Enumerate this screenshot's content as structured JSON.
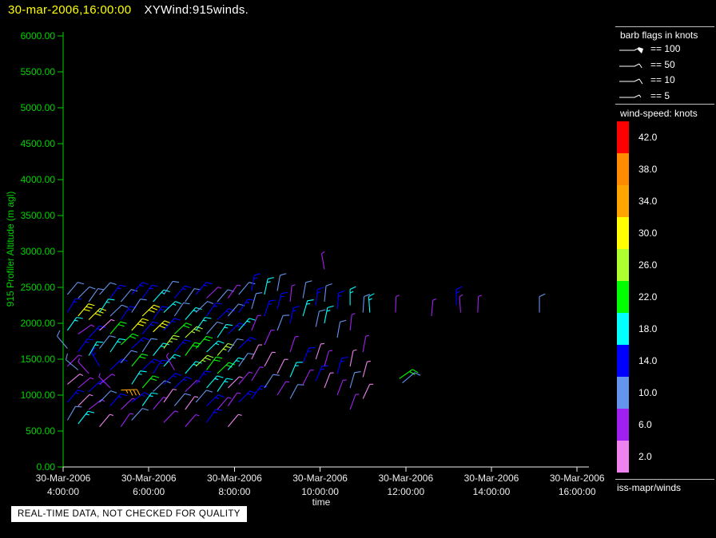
{
  "header": {
    "timestamp": "30-mar-2006,16:00:00",
    "title": "XYWind:915winds."
  },
  "banner": {
    "text": "REAL-TIME DATA, NOT CHECKED FOR QUALITY"
  },
  "legend": {
    "barb_flags_title": "barb flags in knots",
    "barb_flags": [
      {
        "label": "== 100",
        "knots": 100
      },
      {
        "label": "== 50",
        "knots": 50
      },
      {
        "label": "== 10",
        "knots": 10
      },
      {
        "label": "== 5",
        "knots": 5
      }
    ],
    "colorbar_title": "wind-speed: knots",
    "colorbar": [
      {
        "label": "42.0",
        "color": "#ff0000"
      },
      {
        "label": "38.0",
        "color": "#ff8c00"
      },
      {
        "label": "34.0",
        "color": "#ffa500"
      },
      {
        "label": "30.0",
        "color": "#ffff00"
      },
      {
        "label": "26.0",
        "color": "#adff2f"
      },
      {
        "label": "22.0",
        "color": "#00ff00"
      },
      {
        "label": "18.0",
        "color": "#00ffff"
      },
      {
        "label": "14.0",
        "color": "#0000ff"
      },
      {
        "label": "10.0",
        "color": "#6495ed"
      },
      {
        "label": "6.0",
        "color": "#a020f0"
      },
      {
        "label": "2.0",
        "color": "#ee82ee"
      }
    ],
    "footer": "iss-mapr/winds"
  },
  "chart_data": {
    "type": "scatter",
    "variant": "wind-barb-time-height",
    "title": "XYWind:915winds.",
    "xlabel": "time",
    "ylabel": "915 Profiler Altitude (m agl)",
    "axis_colors": {
      "y": "#00d400",
      "x": "#eeeeee"
    },
    "xlim_hours": [
      4.0,
      16.27
    ],
    "ylim": [
      0,
      6000
    ],
    "x_ticks": [
      {
        "hour": 4,
        "date": "30-Mar-2006",
        "time": "4:00:00"
      },
      {
        "hour": 6,
        "date": "30-Mar-2006",
        "time": "6:00:00"
      },
      {
        "hour": 8,
        "date": "30-Mar-2006",
        "time": "8:00:00"
      },
      {
        "hour": 10,
        "date": "30-Mar-2006",
        "time": "10:00:00"
      },
      {
        "hour": 12,
        "date": "30-Mar-2006",
        "time": "12:00:00"
      },
      {
        "hour": 14,
        "date": "30-Mar-2006",
        "time": "14:00:00"
      },
      {
        "hour": 16,
        "date": "30-Mar-2006",
        "time": "16:00:00"
      }
    ],
    "y_ticks": [
      {
        "value": 0,
        "label": "0.00"
      },
      {
        "value": 500,
        "label": "500.00"
      },
      {
        "value": 1000,
        "label": "1000.00"
      },
      {
        "value": 1500,
        "label": "1500.00"
      },
      {
        "value": 2000,
        "label": "2000.00"
      },
      {
        "value": 2500,
        "label": "2500.00"
      },
      {
        "value": 3000,
        "label": "3000.00"
      },
      {
        "value": 3500,
        "label": "3500.00"
      },
      {
        "value": 4000,
        "label": "4000.00"
      },
      {
        "value": 4500,
        "label": "4500.00"
      },
      {
        "value": 5000,
        "label": "5000.00"
      },
      {
        "value": 5500,
        "label": "5500.00"
      },
      {
        "value": 6000,
        "label": "6000.00"
      }
    ],
    "points_format": [
      "hour",
      "altitude_m",
      "speed_knots",
      "direction_deg"
    ],
    "points": [
      [
        4.1,
        2400,
        10,
        40
      ],
      [
        4.1,
        2150,
        14,
        30
      ],
      [
        4.1,
        1900,
        18,
        35
      ],
      [
        4.1,
        1650,
        10,
        320
      ],
      [
        4.1,
        1400,
        6,
        45
      ],
      [
        4.1,
        1150,
        2,
        50
      ],
      [
        4.1,
        900,
        14,
        40
      ],
      [
        4.1,
        650,
        10,
        30
      ],
      [
        4.35,
        2350,
        10,
        45
      ],
      [
        4.35,
        2100,
        30,
        40
      ],
      [
        4.35,
        1850,
        6,
        55
      ],
      [
        4.35,
        1600,
        14,
        35
      ],
      [
        4.35,
        1350,
        10,
        310
      ],
      [
        4.35,
        1100,
        6,
        50
      ],
      [
        4.35,
        850,
        2,
        45
      ],
      [
        4.35,
        600,
        18,
        38
      ],
      [
        4.6,
        2300,
        10,
        35
      ],
      [
        4.6,
        2050,
        30,
        45
      ],
      [
        4.6,
        1800,
        14,
        42
      ],
      [
        4.6,
        1550,
        18,
        30
      ],
      [
        4.6,
        1300,
        6,
        318
      ],
      [
        4.6,
        1050,
        14,
        48
      ],
      [
        4.6,
        800,
        6,
        52
      ],
      [
        4.85,
        2400,
        10,
        42
      ],
      [
        4.85,
        2150,
        18,
        33
      ],
      [
        4.85,
        1900,
        2,
        47
      ],
      [
        4.85,
        1650,
        10,
        38
      ],
      [
        4.85,
        1400,
        14,
        330
      ],
      [
        4.85,
        1150,
        6,
        50
      ],
      [
        4.85,
        900,
        10,
        44
      ],
      [
        4.85,
        560,
        2,
        40
      ],
      [
        5.1,
        2350,
        14,
        36
      ],
      [
        5.1,
        2100,
        10,
        46
      ],
      [
        5.1,
        1850,
        22,
        40
      ],
      [
        5.1,
        1600,
        18,
        34
      ],
      [
        5.1,
        1350,
        14,
        46
      ],
      [
        5.1,
        1100,
        6,
        315
      ],
      [
        5.1,
        850,
        14,
        41
      ],
      [
        5.35,
        2300,
        10,
        40
      ],
      [
        5.35,
        2050,
        14,
        34
      ],
      [
        5.35,
        1700,
        22,
        46
      ],
      [
        5.35,
        1450,
        10,
        40
      ],
      [
        5.35,
        1070,
        34,
        88
      ],
      [
        5.35,
        800,
        6,
        46
      ],
      [
        5.35,
        560,
        6,
        34
      ],
      [
        5.6,
        2400,
        14,
        41
      ],
      [
        5.6,
        2150,
        10,
        33
      ],
      [
        5.6,
        1900,
        30,
        42
      ],
      [
        5.6,
        1650,
        14,
        47
      ],
      [
        5.6,
        1400,
        22,
        39
      ],
      [
        5.6,
        1150,
        18,
        33
      ],
      [
        5.6,
        900,
        14,
        52
      ],
      [
        5.6,
        650,
        10,
        42
      ],
      [
        5.85,
        2350,
        14,
        36
      ],
      [
        5.85,
        2100,
        30,
        46
      ],
      [
        5.85,
        1850,
        14,
        40
      ],
      [
        5.85,
        1600,
        10,
        33
      ],
      [
        5.85,
        1350,
        14,
        47
      ],
      [
        5.85,
        1100,
        22,
        41
      ],
      [
        5.85,
        850,
        18,
        35
      ],
      [
        6.1,
        2300,
        18,
        42
      ],
      [
        6.1,
        2050,
        14,
        34
      ],
      [
        6.1,
        1880,
        30,
        46
      ],
      [
        6.1,
        1550,
        18,
        39
      ],
      [
        6.1,
        1300,
        14,
        33
      ],
      [
        6.1,
        1050,
        10,
        47
      ],
      [
        6.1,
        800,
        6,
        40
      ],
      [
        6.35,
        2400,
        10,
        34
      ],
      [
        6.35,
        2150,
        18,
        46
      ],
      [
        6.35,
        1900,
        14,
        41
      ],
      [
        6.35,
        1650,
        26,
        36
      ],
      [
        6.35,
        1400,
        18,
        42
      ],
      [
        6.35,
        1150,
        14,
        46
      ],
      [
        6.35,
        900,
        2,
        35
      ],
      [
        6.35,
        620,
        6,
        44
      ],
      [
        6.6,
        2350,
        14,
        40
      ],
      [
        6.6,
        2100,
        10,
        34
      ],
      [
        6.6,
        1850,
        22,
        46
      ],
      [
        6.6,
        1600,
        14,
        40
      ],
      [
        6.6,
        1350,
        6,
        330
      ],
      [
        6.6,
        1100,
        14,
        46
      ],
      [
        6.6,
        850,
        10,
        40
      ],
      [
        6.85,
        2300,
        10,
        35
      ],
      [
        6.85,
        2050,
        18,
        41
      ],
      [
        6.85,
        1800,
        26,
        46
      ],
      [
        6.85,
        1550,
        22,
        36
      ],
      [
        6.85,
        1300,
        18,
        41
      ],
      [
        6.85,
        1050,
        6,
        46
      ],
      [
        6.85,
        800,
        2,
        36
      ],
      [
        6.85,
        560,
        6,
        41
      ],
      [
        7.1,
        2400,
        14,
        40
      ],
      [
        7.1,
        2150,
        10,
        46
      ],
      [
        7.1,
        1900,
        18,
        35
      ],
      [
        7.1,
        1650,
        22,
        41
      ],
      [
        7.1,
        1400,
        26,
        46
      ],
      [
        7.1,
        1150,
        14,
        34
      ],
      [
        7.1,
        900,
        10,
        41
      ],
      [
        7.35,
        2350,
        6,
        46
      ],
      [
        7.35,
        2100,
        14,
        35
      ],
      [
        7.35,
        1850,
        10,
        41
      ],
      [
        7.35,
        1600,
        18,
        46
      ],
      [
        7.35,
        1350,
        22,
        36
      ],
      [
        7.35,
        1100,
        18,
        41
      ],
      [
        7.35,
        850,
        14,
        46
      ],
      [
        7.35,
        620,
        14,
        35
      ],
      [
        7.6,
        2300,
        10,
        41
      ],
      [
        7.6,
        2050,
        14,
        46
      ],
      [
        7.6,
        1800,
        18,
        34
      ],
      [
        7.6,
        1550,
        26,
        41
      ],
      [
        7.6,
        1300,
        22,
        46
      ],
      [
        7.6,
        1050,
        18,
        35
      ],
      [
        7.6,
        800,
        6,
        41
      ],
      [
        7.85,
        2350,
        6,
        35
      ],
      [
        7.85,
        2100,
        10,
        41
      ],
      [
        7.85,
        1850,
        14,
        46
      ],
      [
        7.85,
        1600,
        10,
        35
      ],
      [
        7.85,
        1350,
        18,
        40
      ],
      [
        7.85,
        1100,
        2,
        45
      ],
      [
        7.85,
        850,
        6,
        35
      ],
      [
        7.85,
        560,
        2,
        40
      ],
      [
        8.1,
        2400,
        10,
        40
      ],
      [
        8.1,
        2150,
        14,
        34
      ],
      [
        8.1,
        1900,
        18,
        41
      ],
      [
        8.1,
        1650,
        14,
        46
      ],
      [
        8.1,
        1400,
        10,
        35
      ],
      [
        8.1,
        1150,
        6,
        40
      ],
      [
        8.1,
        900,
        14,
        45
      ],
      [
        8.4,
        2450,
        14,
        10
      ],
      [
        8.4,
        2200,
        10,
        16
      ],
      [
        8.4,
        1900,
        6,
        22
      ],
      [
        8.4,
        1500,
        2,
        26
      ],
      [
        8.4,
        1200,
        6,
        31
      ],
      [
        8.4,
        950,
        14,
        36
      ],
      [
        8.7,
        2400,
        18,
        12
      ],
      [
        8.7,
        2100,
        14,
        18
      ],
      [
        8.7,
        1700,
        6,
        24
      ],
      [
        8.7,
        1400,
        2,
        28
      ],
      [
        8.7,
        1100,
        10,
        33
      ],
      [
        9.0,
        2450,
        10,
        10
      ],
      [
        9.0,
        2200,
        14,
        15
      ],
      [
        9.0,
        1900,
        10,
        21
      ],
      [
        9.0,
        1300,
        2,
        27
      ],
      [
        9.0,
        1000,
        6,
        32
      ],
      [
        9.3,
        2300,
        6,
        6
      ],
      [
        9.3,
        2000,
        14,
        12
      ],
      [
        9.3,
        1600,
        6,
        18
      ],
      [
        9.3,
        1250,
        18,
        23
      ],
      [
        9.3,
        950,
        10,
        28
      ],
      [
        9.6,
        2350,
        10,
        10
      ],
      [
        9.6,
        2100,
        18,
        16
      ],
      [
        9.6,
        1450,
        14,
        22
      ],
      [
        9.6,
        1150,
        6,
        27
      ],
      [
        9.9,
        2250,
        14,
        6
      ],
      [
        9.9,
        1950,
        10,
        12
      ],
      [
        9.9,
        1500,
        2,
        18
      ],
      [
        9.9,
        1200,
        14,
        23
      ],
      [
        10.1,
        2750,
        6,
        350
      ],
      [
        10.1,
        2300,
        10,
        6
      ],
      [
        10.1,
        2000,
        18,
        11
      ],
      [
        10.1,
        1400,
        6,
        16
      ],
      [
        10.1,
        1100,
        2,
        21
      ],
      [
        10.4,
        2200,
        14,
        5
      ],
      [
        10.4,
        1800,
        10,
        10
      ],
      [
        10.4,
        1300,
        14,
        16
      ],
      [
        10.4,
        1000,
        6,
        21
      ],
      [
        10.7,
        2250,
        18,
        0
      ],
      [
        10.7,
        1900,
        6,
        6
      ],
      [
        10.7,
        1400,
        2,
        11
      ],
      [
        10.7,
        1100,
        10,
        16
      ],
      [
        10.7,
        800,
        6,
        20
      ],
      [
        11.0,
        2150,
        10,
        4
      ],
      [
        11.0,
        1600,
        6,
        10
      ],
      [
        11.0,
        1250,
        2,
        15
      ],
      [
        11.0,
        950,
        2,
        25
      ],
      [
        11.16,
        2150,
        18,
        356
      ],
      [
        11.76,
        2150,
        6,
        2
      ],
      [
        11.85,
        1230,
        22,
        55
      ],
      [
        11.92,
        1170,
        10,
        50
      ],
      [
        12.6,
        2100,
        6,
        5
      ],
      [
        13.18,
        2250,
        14,
        0
      ],
      [
        13.28,
        2150,
        6,
        356
      ],
      [
        13.68,
        2150,
        6,
        2
      ],
      [
        15.12,
        2150,
        10,
        0
      ]
    ]
  }
}
